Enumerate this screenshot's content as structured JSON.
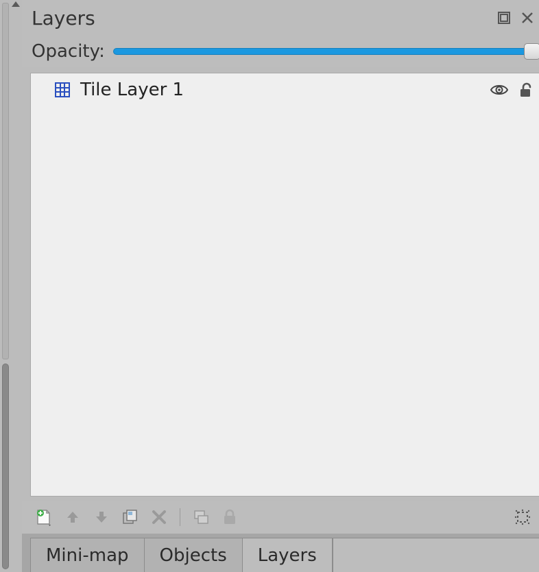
{
  "panel": {
    "title": "Layers"
  },
  "opacity": {
    "label": "Opacity:",
    "value_percent": 100
  },
  "layers": [
    {
      "name": "Tile Layer 1",
      "type": "tile",
      "visible": true,
      "locked": false
    }
  ],
  "toolbar": {
    "new_layer": "new-layer",
    "move_up": "move-up",
    "move_down": "move-down",
    "duplicate": "duplicate",
    "delete": "delete",
    "merge": "merge",
    "lock": "lock",
    "highlight": "highlight-current"
  },
  "tabs": [
    {
      "id": "minimap",
      "label": "Mini-map",
      "active": false
    },
    {
      "id": "objects",
      "label": "Objects",
      "active": false
    },
    {
      "id": "layers",
      "label": "Layers",
      "active": true
    }
  ],
  "colors": {
    "bg": "#bcbcbc",
    "panel": "#bdbdbd",
    "list_bg": "#efefef",
    "accent": "#1b98e0"
  }
}
